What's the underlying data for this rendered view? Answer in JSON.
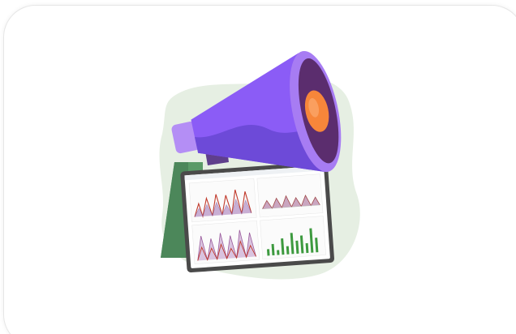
{
  "card": {
    "background": "#ffffff",
    "border_color": "#e6e6e6"
  },
  "illustration": {
    "icon": "megaphone-dashboard-illustration",
    "colors": {
      "blob": "#e6efe3",
      "megaphone_body": "#8b5cf6",
      "megaphone_body_dark": "#6d4ad8",
      "megaphone_bell_rim": "#a77cf3",
      "megaphone_inner": "#5b2d6e",
      "speaker_orange": "#f7863a",
      "handle": "#5f3f8c",
      "stand_green": "#5a9a67",
      "tablet_frame": "#4a4a4a",
      "screen": "#ffffff",
      "bar_green": "#3d9a3f",
      "chart_red": "#c0392b",
      "chart_purple": "#8e6aa8"
    }
  }
}
